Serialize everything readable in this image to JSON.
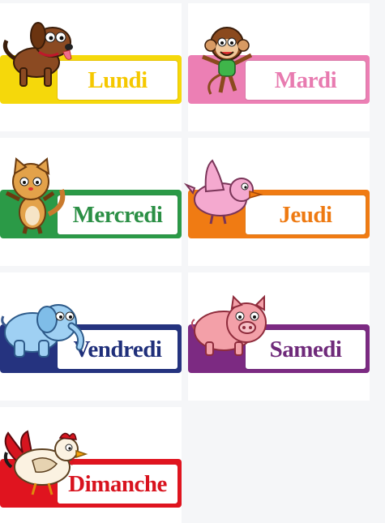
{
  "days": [
    {
      "label": "Lundi",
      "color": "#f5d80b",
      "animal": "dog-icon"
    },
    {
      "label": "Mardi",
      "color": "#ec7fb4",
      "animal": "monkey-icon"
    },
    {
      "label": "Mercredi",
      "color": "#2b9a47",
      "animal": "cat-icon"
    },
    {
      "label": "Jeudi",
      "color": "#f07b13",
      "animal": "bird-icon"
    },
    {
      "label": "Vendredi",
      "color": "#25337f",
      "animal": "elephant-icon"
    },
    {
      "label": "Samedi",
      "color": "#7c2a82",
      "animal": "pig-icon"
    },
    {
      "label": "Dimanche",
      "color": "#e0141f",
      "animal": "rooster-icon"
    }
  ]
}
